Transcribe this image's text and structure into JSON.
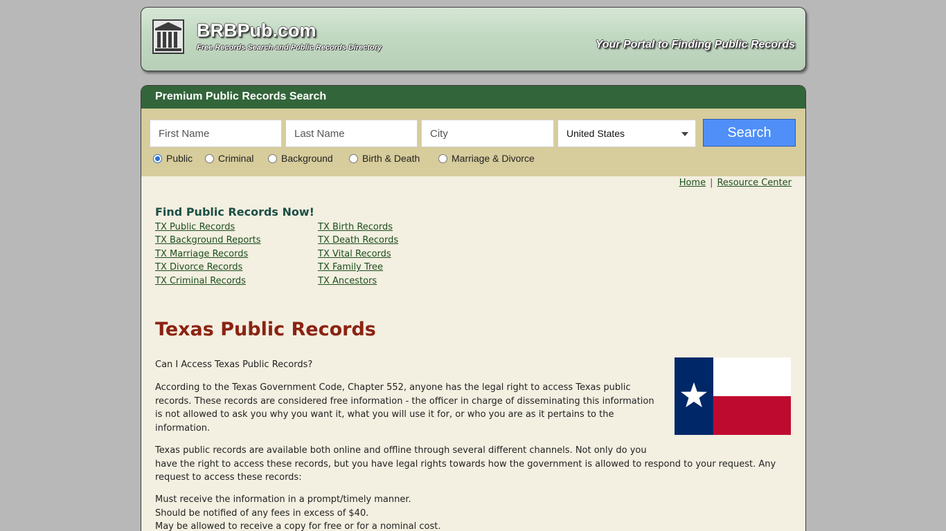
{
  "header": {
    "site_name": "BRBPub.com",
    "tagline": "Free Records Search and Public Records Directory",
    "slogan": "Your Portal to Finding Public Records"
  },
  "search": {
    "title": "Premium Public Records Search",
    "first_name_placeholder": "First Name",
    "last_name_placeholder": "Last Name",
    "city_placeholder": "City",
    "country_selected": "United States",
    "button_label": "Search",
    "record_types": [
      {
        "label": "Public",
        "selected": true
      },
      {
        "label": "Criminal",
        "selected": false
      },
      {
        "label": "Background",
        "selected": false
      },
      {
        "label": "Birth & Death",
        "selected": false
      },
      {
        "label": "Marriage & Divorce",
        "selected": false
      }
    ]
  },
  "nav": {
    "home": "Home",
    "resource_center": "Resource Center"
  },
  "find_records": {
    "title": "Find Public Records Now!",
    "left_links": [
      "TX Public Records",
      "TX Background Reports",
      "TX Marriage Records",
      "TX Divorce Records",
      "TX Criminal Records"
    ],
    "right_links": [
      "TX Birth Records",
      "TX Death Records",
      "TX Vital Records",
      "TX Family Tree",
      "TX Ancestors"
    ]
  },
  "article": {
    "title": "Texas Public Records",
    "question": "Can I Access Texas Public Records?",
    "p1_lines": [
      "According to the Texas Government Code, Chapter 552, anyone has the legal right to access Texas public",
      "records. These records are considered free information - the officer in charge of disseminating this information",
      "is not allowed to ask you why you want it, what you will use it for, or who you are as it pertains to the",
      "information."
    ],
    "p2_lines": [
      "Texas public records are available both online and offline through several different channels. Not only do you",
      "have the right to access these records, but you have legal rights towards how the government is allowed to respond to your request. Any",
      "request to access these records:"
    ],
    "list_lines": [
      "Must receive the information in a prompt/timely manner.",
      "Should be notified of any fees in excess of $40.",
      "May be allowed to receive a copy for free or for a nominal cost."
    ]
  },
  "colors": {
    "search_bar": "#33653a",
    "search_panel": "#d7cc9b",
    "content_bg": "#f3efe1",
    "title_red": "#8b2312",
    "button_blue": "#4f8ff7",
    "flag_blue": "#002868",
    "flag_red": "#bf0a30"
  }
}
